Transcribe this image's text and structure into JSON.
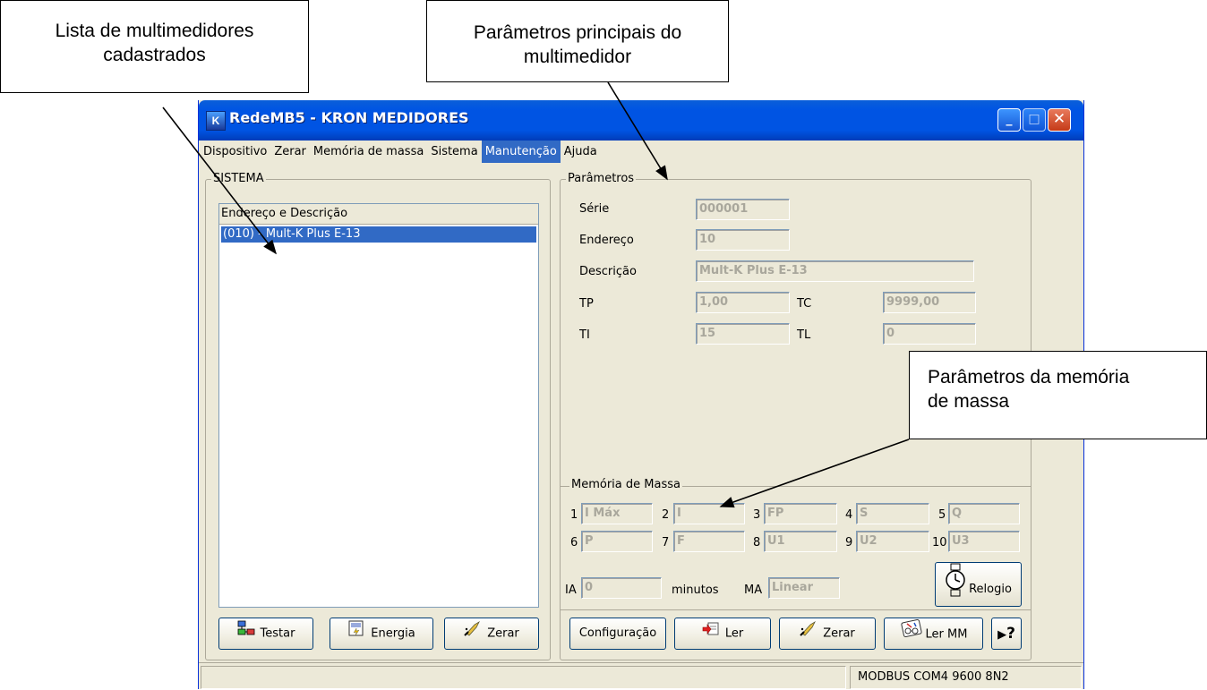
{
  "callouts": {
    "list": {
      "line1": "Lista de multimedidores",
      "line2": "cadastrados"
    },
    "params": {
      "line1": "Parâmetros principais do",
      "line2": "multimedidor"
    },
    "memory": {
      "line1": "Parâmetros da memória",
      "line2": "de massa"
    }
  },
  "window": {
    "title": "RedeMB5 - KRON MEDIDORES",
    "icon_letter": "K",
    "controls": {
      "minimize": "minimize-icon",
      "maximize": "maximize-icon",
      "close": "close-icon"
    }
  },
  "menu": {
    "items": [
      "Dispositivo",
      "Zerar",
      "Memória de massa",
      "Sistema",
      "Manutenção",
      "Ajuda"
    ],
    "active": "Manutenção"
  },
  "sistema": {
    "group_label": "SISTEMA",
    "list_header": "Endereço e Descrição",
    "rows": [
      "(010) - Mult-K Plus E-13"
    ],
    "buttons": {
      "testar": "Testar",
      "energia": "Energia",
      "zerar": "Zerar"
    }
  },
  "parametros": {
    "group_label": "Parâmetros",
    "serie_label": "Série",
    "serie": "000001",
    "endereco_label": "Endereço",
    "endereco": "10",
    "descricao_label": "Descrição",
    "descricao": "Mult-K Plus E-13",
    "tp_label": "TP",
    "tp": "1,00",
    "tc_label": "TC",
    "tc": "9999,00",
    "ti_label": "TI",
    "ti": "15",
    "tl_label": "TL",
    "tl": "0"
  },
  "memoria": {
    "group_label": "Memória de Massa",
    "channels": [
      {
        "n": "1",
        "v": "I Máx"
      },
      {
        "n": "2",
        "v": "I"
      },
      {
        "n": "3",
        "v": "FP"
      },
      {
        "n": "4",
        "v": "S"
      },
      {
        "n": "5",
        "v": "Q"
      },
      {
        "n": "6",
        "v": "P"
      },
      {
        "n": "7",
        "v": "F"
      },
      {
        "n": "8",
        "v": "U1"
      },
      {
        "n": "9",
        "v": "U2"
      },
      {
        "n": "10",
        "v": "U3"
      }
    ],
    "ia_label": "IA",
    "ia": "0",
    "minutos": "minutos",
    "ma_label": "MA",
    "ma": "Linear",
    "relogio": "Relogio"
  },
  "bottom_buttons": {
    "configuracao": "Configuração",
    "ler": "Ler",
    "zerar": "Zerar",
    "ler_mm": "Ler MM",
    "help_icon": "?"
  },
  "status": {
    "right": "MODBUS COM4 9600 8N2"
  }
}
